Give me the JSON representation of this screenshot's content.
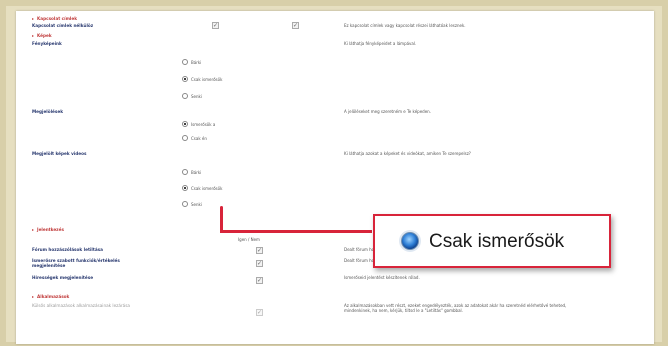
{
  "sections": {
    "s1": "Kapcsolat címlek",
    "s2": "Képek",
    "s3": "Jelentkezés",
    "s4": "Alkalmazások"
  },
  "rows": {
    "r1_label": "Kapcsolat címlek nélkülöz",
    "r1_desc": "Ez kapcsolat címlek vagy kapcsolat részei láthatóak lesznek.",
    "r2_label": "Fényképeink",
    "r2_desc": "Ki láthatja fényképeidet a lámpával.",
    "r2_opts": [
      "Bárki",
      "Csak ismerősök",
      "Senki"
    ],
    "r3_label": "Megjelölések",
    "r3_desc": "A jelöléseket meg szeretném e Te képeden.",
    "r3_opts": [
      "Ismerősök a",
      "Csak én"
    ],
    "r4_label": "Megjelölt képek videos",
    "r4_desc": "Ki láthatja azokat a képeket és videókat, amiken Te szerepelsz?",
    "r4_opts": [
      "Bárki",
      "Csak ismerősök",
      "Senki"
    ],
    "r5_label": "Fórum hozzászólások letiltása",
    "r5_desc": "Dealt fórum hozzászólások ...",
    "r6_label": "Ismerősre szabott funkciók/értékelés megjelenítése",
    "r6_desc": "Dealt fórum hozzá ismerőseid a kérdésekre szavazhatnak a táblázatban.",
    "r7_label": "Hírességek megjelenítése",
    "r7_desc": "Ismerőseid jelentést készítenek rólad.",
    "r8_label": "Külsős alkalmazások alkalmazásainak lezárása",
    "r8_desc": "Az alkalmazásokban vett részt, ezeket engedélyezték, azok az adatokat akár ha szeretnéd elérhetővé teheted, mindenkinek, ha nem, kérjük, tiltsd le a \"Letiltás\" gombbal."
  },
  "colhead": "Igen / Nem",
  "callout": {
    "label": "Csak ismerősök"
  }
}
